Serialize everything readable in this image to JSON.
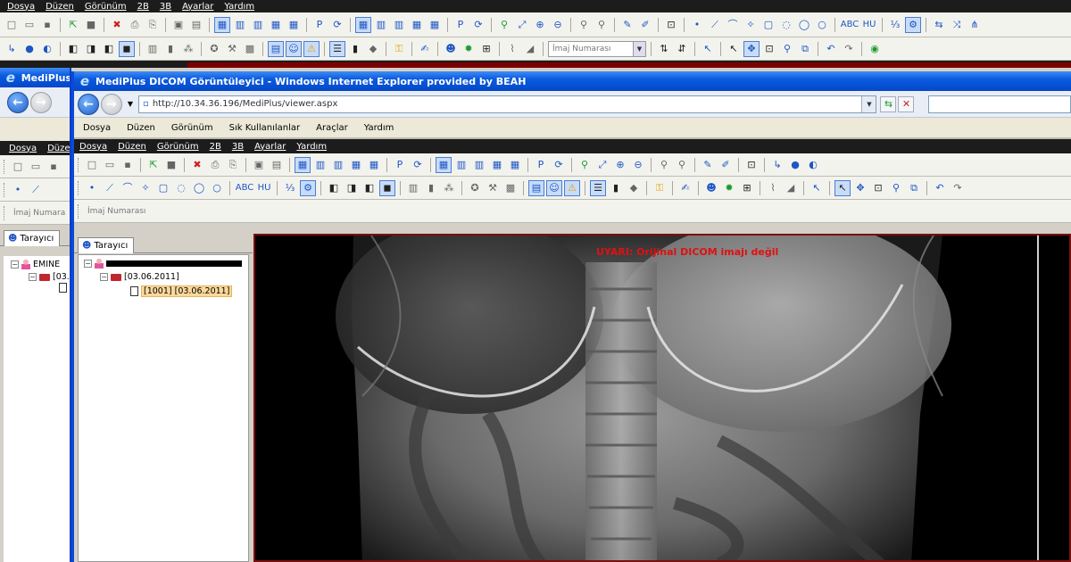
{
  "back_app": {
    "menu": [
      "Dosya",
      "Düzen",
      "Görünüm",
      "2B",
      "3B",
      "Ayarlar",
      "Yardım"
    ],
    "image_number_placeholder": "İmaj Numarası",
    "abc_label": "ABC",
    "hu_label": "HU"
  },
  "left_window": {
    "title": "MediPlus",
    "menu": [
      "Dosya",
      "Düze"
    ],
    "image_number_placeholder": "İmaj Numara",
    "tab_label": "Tarayıcı",
    "patient_label": "EMINE",
    "study_label": "[03."
  },
  "browser": {
    "title": "MediPlus DICOM Görüntüleyici - Windows Internet Explorer provided by BEAH",
    "address": "http://10.34.36.196/MediPlus/viewer.aspx",
    "ie_menu": [
      "Dosya",
      "Düzen",
      "Görünüm",
      "Sık Kullanılanlar",
      "Araçlar",
      "Yardım"
    ]
  },
  "viewer": {
    "menu": [
      "Dosya",
      "Düzen",
      "Görünüm",
      "2B",
      "3B",
      "Ayarlar",
      "Yardım"
    ],
    "abc_label": "ABC",
    "hu_label": "HU",
    "image_number_placeholder": "İmaj Numarası",
    "tab_label": "Tarayıcı",
    "study_date": "[03.06.2011]",
    "series_label": "[1001] [03.06.2011]",
    "warning": "UYARI: Orijinal DICOM imajı değil"
  },
  "colors": {
    "warning": "#e01010",
    "selection": "#fbd89b",
    "titlebar": "#0a5ae0"
  }
}
